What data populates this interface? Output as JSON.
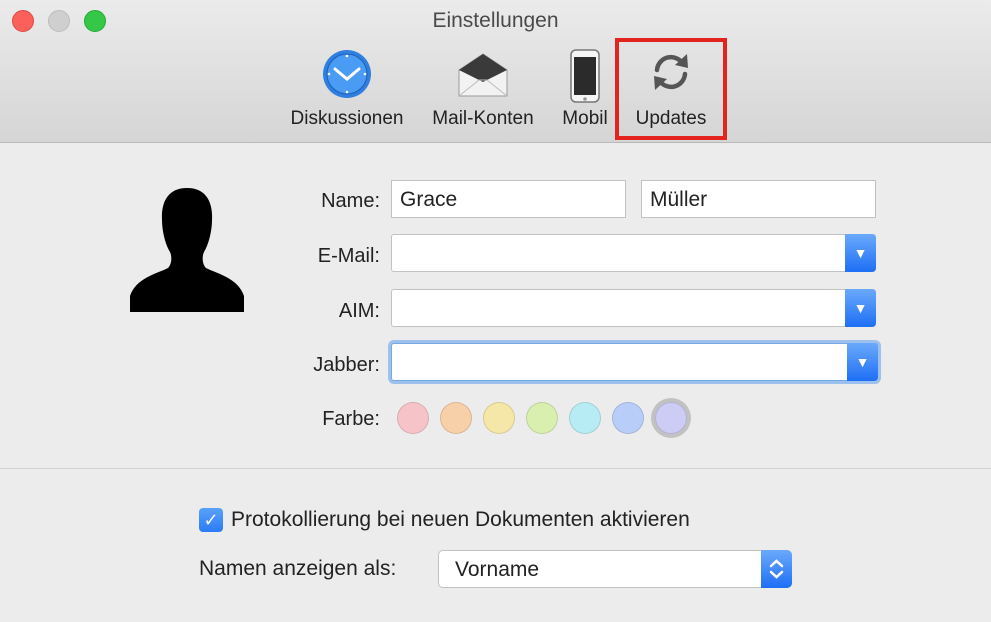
{
  "window": {
    "title": "Einstellungen"
  },
  "toolbar": {
    "items": [
      {
        "label": "Diskussionen",
        "icon": "clock-icon"
      },
      {
        "label": "Mail-Konten",
        "icon": "envelope-icon"
      },
      {
        "label": "Mobil",
        "icon": "phone-icon"
      },
      {
        "label": "Updates",
        "icon": "refresh-icon"
      }
    ],
    "highlighted": "Updates",
    "highlight_color": "#e3231e"
  },
  "form": {
    "name_label": "Name:",
    "first_name": "Grace",
    "last_name": "Müller",
    "email_label": "E-Mail:",
    "email_value": "",
    "aim_label": "AIM:",
    "aim_value": "",
    "jabber_label": "Jabber:",
    "jabber_value": "",
    "color_label": "Farbe:",
    "colors": [
      "#f6c4c8",
      "#f7cfa8",
      "#f5e7a8",
      "#d8efb0",
      "#b8ecf4",
      "#b8cdf8",
      "#ccccf4"
    ],
    "selected_color": "#ccccf4"
  },
  "options": {
    "logging_checkbox_label": "Protokollierung bei neuen Dokumenten aktivieren",
    "logging_checked": true,
    "display_name_label": "Namen anzeigen als:",
    "display_name_value": "Vorname"
  }
}
